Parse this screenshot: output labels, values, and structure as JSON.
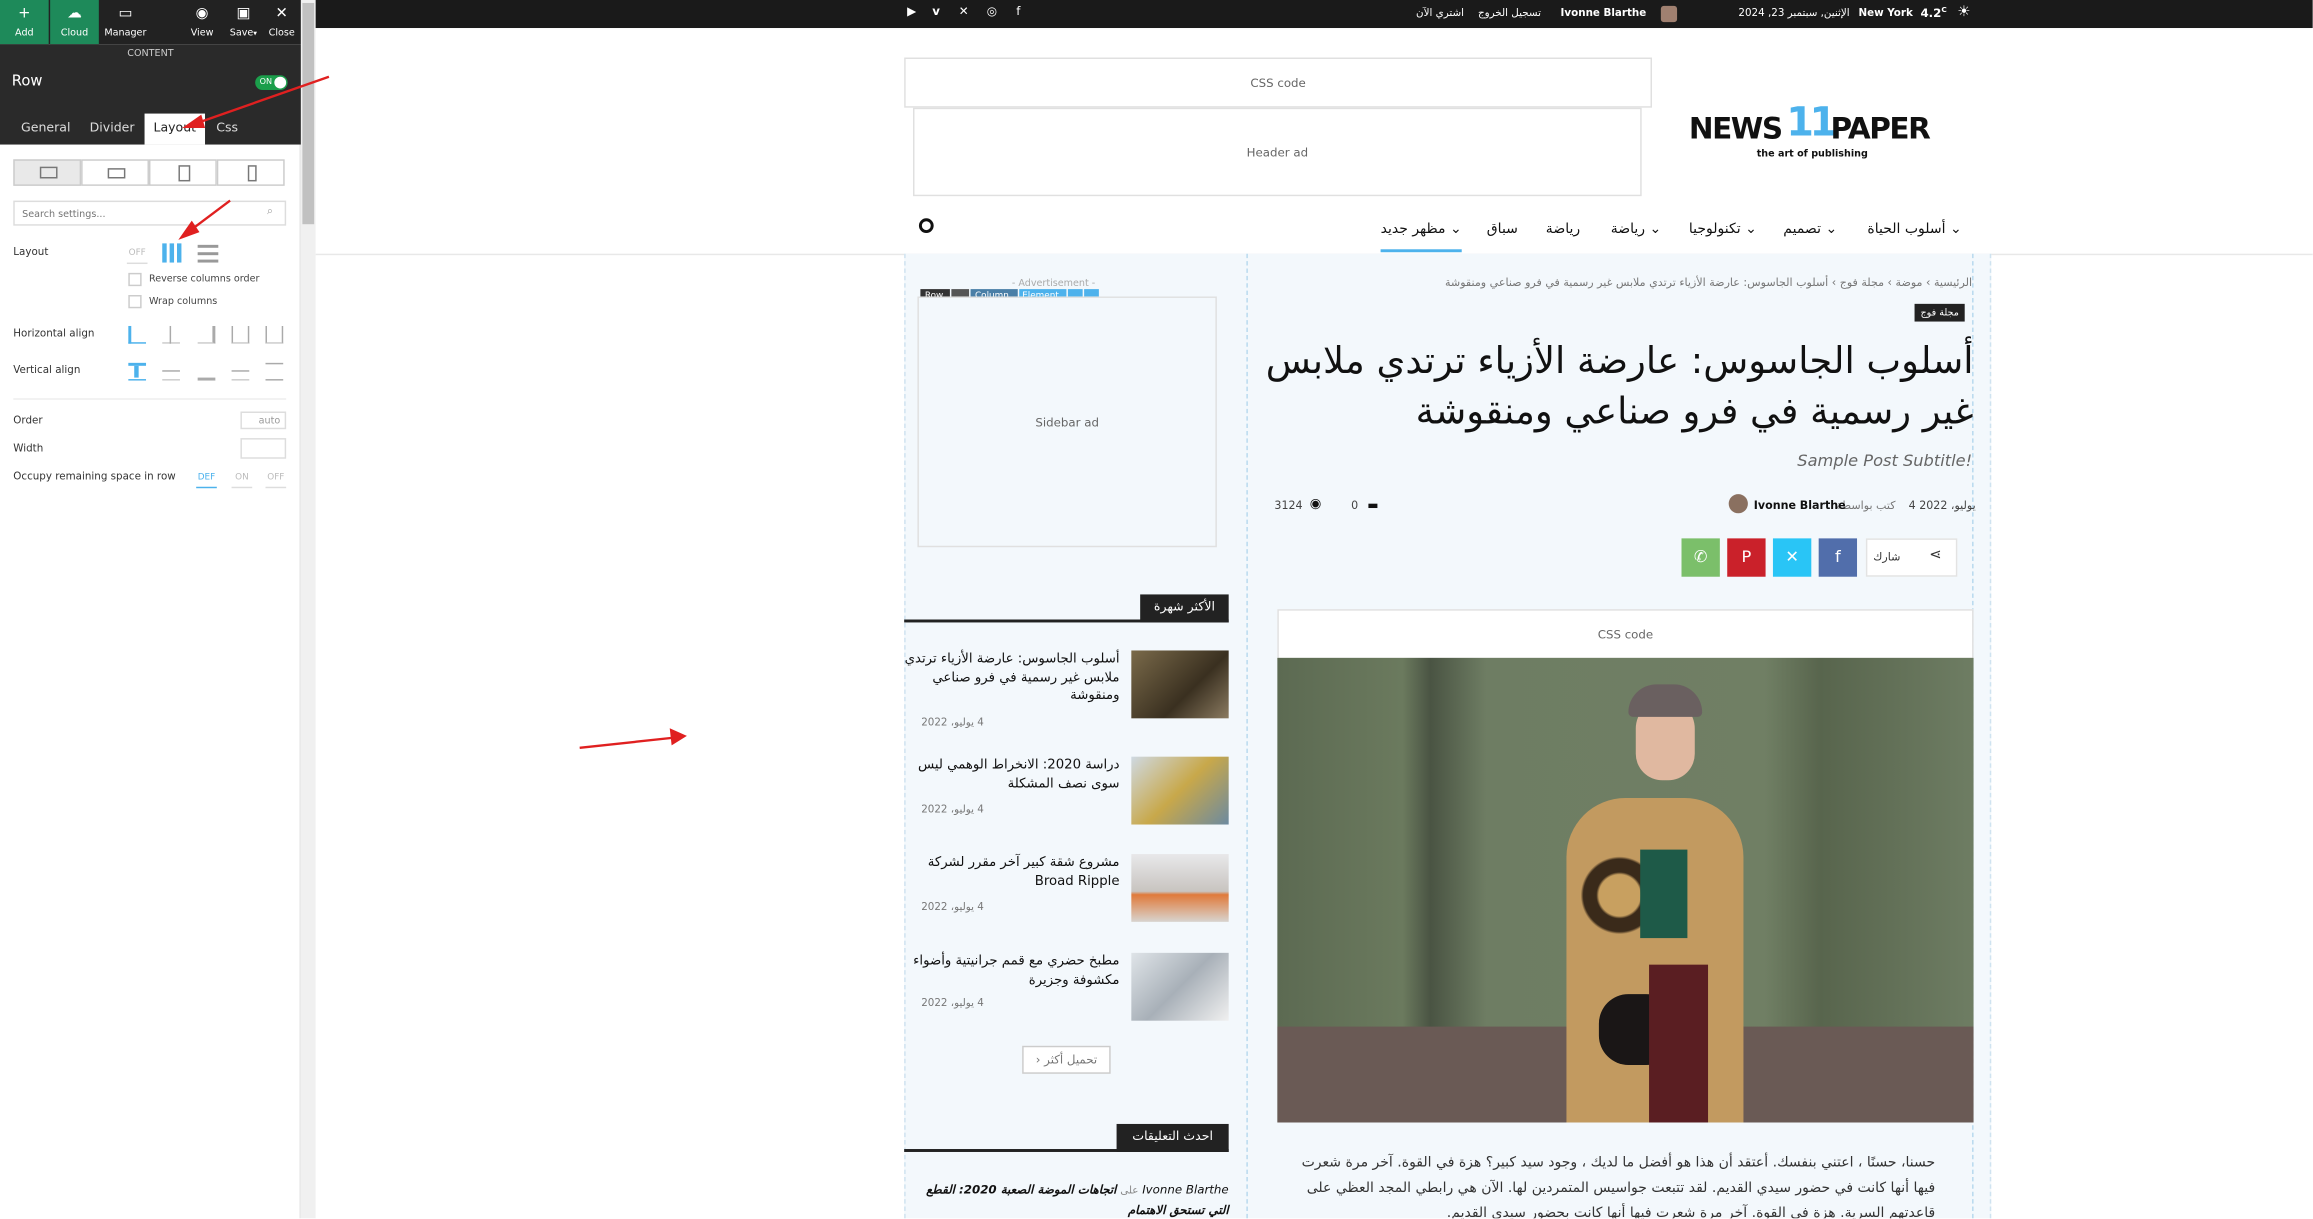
{
  "editor": {
    "toolbar": [
      {
        "label": "Add",
        "icon": "plus-icon"
      },
      {
        "label": "Cloud",
        "icon": "cloud-icon"
      },
      {
        "label": "Manager",
        "icon": "manager-icon"
      },
      {
        "label": "View",
        "icon": "eye-icon"
      },
      {
        "label": "Save",
        "icon": "save-icon"
      },
      {
        "label": "Close",
        "icon": "close-icon"
      }
    ],
    "section_label": "CONTENT",
    "element_title": "Row",
    "toggle_label": "ON",
    "tabs": [
      "General",
      "Divider",
      "Layout",
      "Css"
    ],
    "active_tab": "Layout",
    "search_placeholder": "Search settings...",
    "layout_label": "Layout",
    "layout_off": "OFF",
    "reverse_label": "Reverse columns order",
    "wrap_label": "Wrap columns",
    "halign_label": "Horizontal align",
    "valign_label": "Vertical align",
    "order_label": "Order",
    "order_value": "auto",
    "width_label": "Width",
    "occupy_label": "Occupy remaining space in row",
    "occupy_options": [
      "DEF",
      "ON",
      "OFF"
    ]
  },
  "topbar": {
    "weather_temp": "4.2",
    "weather_unit": "C",
    "city": "New York",
    "date": "الإثنين, سبتمبر 23, 2024",
    "user": "Ivonne Blarthe",
    "logout": "تسجيل الخروج",
    "buy": "اشتري الآن",
    "social": [
      "facebook-icon",
      "instagram-icon",
      "x-icon",
      "vimeo-icon",
      "youtube-icon"
    ]
  },
  "header": {
    "css_code": "CSS code",
    "header_ad": "Header ad",
    "logo_news": "NEWS",
    "logo_num": "11",
    "logo_paper": "PAPER",
    "logo_tagline": "the art of publishing"
  },
  "nav": {
    "items": [
      "أسلوب الحياة",
      "تصميم",
      "تكنولوجيا",
      "رياضة",
      "رياضة",
      "سباق",
      "مظهر جديد"
    ]
  },
  "sidebar": {
    "ad_note": "- Advertisement -",
    "row_tools": [
      "Row",
      "Column",
      "Element"
    ],
    "sidebar_ad": "Sidebar ad",
    "popular_title": "الأكثر شهرة",
    "items": [
      {
        "title": "أسلوب الجاسوس: عارضة الأزياء ترتدي ملابس غير رسمية في فرو صناعي ومنقوشة",
        "date": "4 يوليو، 2022"
      },
      {
        "title": "دراسة 2020: الانخراط الوهمي ليس سوى نصف المشكلة",
        "date": "4 يوليو، 2022"
      },
      {
        "title": "مشروع شقة كبير آخر مقرر لشركة Broad Ripple",
        "date": "4 يوليو، 2022"
      },
      {
        "title": "مطبخ حضري مع قمم جرانيتية وأضواء مكشوفة وجزيرة",
        "date": "4 يوليو، 2022"
      }
    ],
    "load_more": "تحميل أكثر",
    "comments_title": "احدث التعليقات",
    "comment_author": "Ivonne Blarthe",
    "comment_on": "على",
    "comment_post": "اتجاهات الموضة الصعبة 2020: القطع التي تستحق الاهتمام"
  },
  "article": {
    "breadcrumb": [
      "الرئيسية",
      "موضة",
      "مجلة فوج",
      "أسلوب الجاسوس: عارضة الأزياء ترتدي ملابس غير رسمية في فرو صناعي ومنقوشة"
    ],
    "category": "مجلة فوج",
    "title": "أسلوب الجاسوس: عارضة الأزياء ترتدي ملابس غير رسمية في فرو صناعي ومنقوشة",
    "subtitle": "Sample Post Subtitle!",
    "author_prefix": "كتب بواسطة",
    "author": "Ivonne Blarthe",
    "date": "4 يوليو، 2022",
    "comments": "0",
    "views": "3124",
    "share_label": "شارك",
    "css_code": "CSS code",
    "body": "حسنا، حسنًا ، اعتني بنفسك. أعتقد أن هذا هو أفضل ما لديك ، وجود سيد كبير؟ هزة في القوة. آخر مرة شعرت فيها أنها كانت في حضور سيدي القديم. لقد تتبعت جواسيس المتمردين لها. الآن هي رابطي المجد العظي على قاعدتهم السرية. هزة في القوة. آخر مرة شعرت فيها أنها كانت بحضور سيدي القديم."
  },
  "colors": {
    "accent": "#4db2ec",
    "dark": "#222222",
    "whatsapp": "#7bbf6a",
    "pinterest": "#ca212a",
    "x": "#29c5f6",
    "facebook": "#516eab",
    "arrow": "#e02020"
  }
}
